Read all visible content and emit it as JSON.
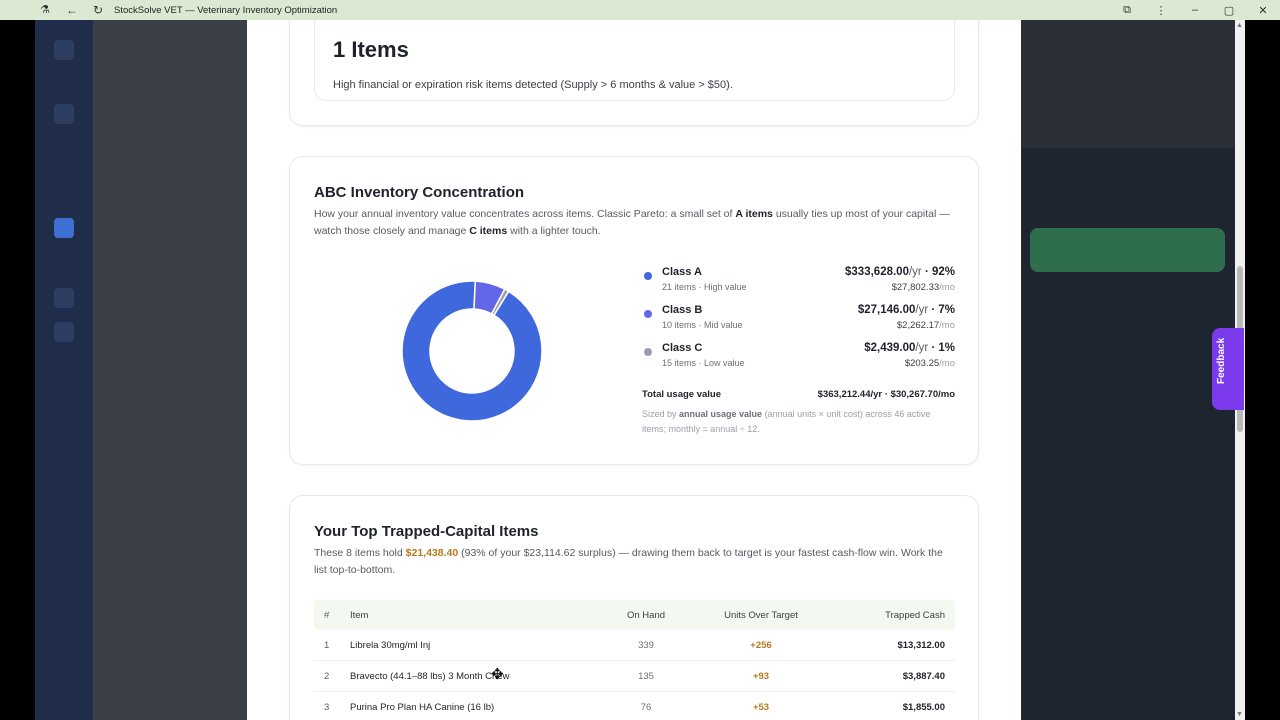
{
  "window": {
    "title": "StockSolve VET — Veterinary Inventory Optimization"
  },
  "risk_card": {
    "count_label": "1 Items",
    "note": "High financial or expiration risk items detected (Supply > 6 months & value > $50)."
  },
  "abc": {
    "title": "ABC Inventory Concentration",
    "desc_1": "How your annual inventory value concentrates across items. Classic Pareto: a small set of ",
    "desc_a": "A items",
    "desc_2": " usually ties up most of your capital — watch those closely and manage ",
    "desc_c": "C items",
    "desc_3": " with a lighter touch.",
    "classes": [
      {
        "name": "Class A",
        "sub": "21 items · High value",
        "annual": "$333,628.00",
        "annual_unit": "/yr",
        "pct": " · 92%",
        "monthly": "$27,802.33",
        "monthly_unit": "/mo",
        "color": "#3f68dc"
      },
      {
        "name": "Class B",
        "sub": "10 items · Mid value",
        "annual": "$27,146.00",
        "annual_unit": "/yr",
        "pct": " · 7%",
        "monthly": "$2,262.17",
        "monthly_unit": "/mo",
        "color": "#6366e6"
      },
      {
        "name": "Class C",
        "sub": "15 items · Low value",
        "annual": "$2,439.00",
        "annual_unit": "/yr",
        "pct": " · 1%",
        "monthly": "$203.25",
        "monthly_unit": "/mo",
        "color": "#9aa0a8"
      }
    ],
    "total_label": "Total usage value",
    "total_value": "$363,212.44/yr · $30,267.70/mo",
    "sized_1": "Sized by ",
    "sized_b": "annual usage value",
    "sized_2": " (annual units × unit cost) across 46 active items; monthly = annual ÷ 12.",
    "chart_data": {
      "type": "pie",
      "categories": [
        "Class A",
        "Class B",
        "Class C"
      ],
      "values": [
        92,
        7,
        1
      ]
    }
  },
  "trapped": {
    "title": "Your Top Trapped-Capital Items",
    "desc_1": "These 8 items hold ",
    "desc_money": "$21,438.40",
    "desc_2": " (93% of your $23,114.62 surplus) — drawing them back to target is your fastest cash-flow win. Work the list top-to-bottom.",
    "headers": {
      "num": "#",
      "item": "Item",
      "on_hand": "On Hand",
      "over": "Units Over Target",
      "cash": "Trapped Cash"
    },
    "rows": [
      {
        "num": "1",
        "item": "Librela 30mg/ml Inj",
        "on_hand": "339",
        "over": "+256",
        "cash": "$13,312.00"
      },
      {
        "num": "2",
        "item": "Bravecto (44.1–88 lbs) 3 Month Chew",
        "on_hand": "135",
        "over": "+93",
        "cash": "$3,887.40"
      },
      {
        "num": "3",
        "item": "Purina Pro Plan HA Canine (16 lb)",
        "on_hand": "76",
        "over": "+53",
        "cash": "$1,855.00"
      }
    ]
  },
  "feedback": {
    "label": "Feedback"
  }
}
